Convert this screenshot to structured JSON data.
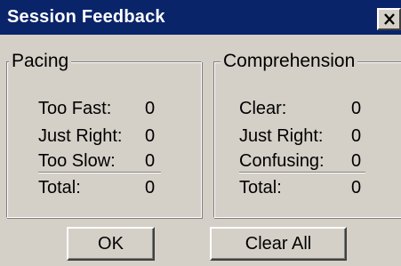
{
  "window": {
    "title": "Session Feedback",
    "close_icon": "close-x-icon"
  },
  "pacing": {
    "legend": "Pacing",
    "rows": [
      {
        "label": "Too Fast:",
        "value": "0"
      },
      {
        "label": "Just Right:",
        "value": "0"
      },
      {
        "label": "Too Slow:",
        "value": "0"
      }
    ],
    "total": {
      "label": "Total:",
      "value": "0"
    }
  },
  "comprehension": {
    "legend": "Comprehension",
    "rows": [
      {
        "label": "Clear:",
        "value": "0"
      },
      {
        "label": "Just Right:",
        "value": "0"
      },
      {
        "label": "Confusing:",
        "value": "0"
      }
    ],
    "total": {
      "label": "Total:",
      "value": "0"
    }
  },
  "buttons": {
    "ok": "OK",
    "clear_all": "Clear All"
  },
  "colors": {
    "titlebar": "#0a246a",
    "face": "#d4d0c8"
  }
}
